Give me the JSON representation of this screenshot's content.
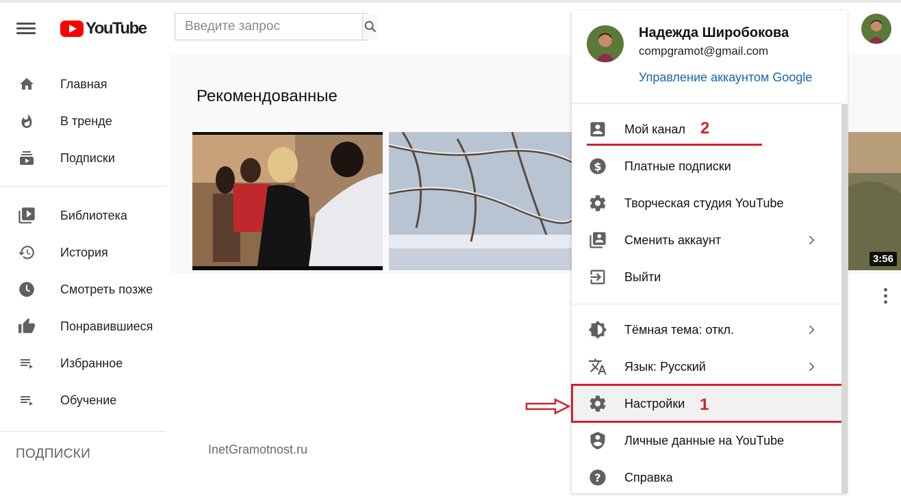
{
  "header": {
    "logo_text": "YouTube",
    "search_placeholder": "Введите запрос"
  },
  "sidebar": {
    "items": [
      {
        "label": "Главная",
        "icon": "home-icon"
      },
      {
        "label": "В тренде",
        "icon": "fire-icon"
      },
      {
        "label": "Подписки",
        "icon": "subscriptions-icon"
      },
      {
        "label": "Библиотека",
        "icon": "library-icon"
      },
      {
        "label": "История",
        "icon": "history-icon"
      },
      {
        "label": "Смотреть позже",
        "icon": "clock-icon"
      },
      {
        "label": "Понравившиеся",
        "icon": "thumbs-up-icon"
      },
      {
        "label": "Избранное",
        "icon": "playlist-icon"
      },
      {
        "label": "Обучение",
        "icon": "playlist-icon"
      }
    ],
    "subscriptions_title": "ПОДПИСКИ"
  },
  "main": {
    "section_title": "Рекомендованные",
    "video_duration": "3:56",
    "watermark": "InetGramotnost.ru"
  },
  "account_menu": {
    "name": "Надежда Широбокова",
    "email": "compgramot@gmail.com",
    "manage_link": "Управление аккаунтом Google",
    "items": [
      {
        "label": "Мой канал",
        "icon": "account-box-icon"
      },
      {
        "label": "Платные подписки",
        "icon": "dollar-icon"
      },
      {
        "label": "Творческая студия YouTube",
        "icon": "gear-icon"
      },
      {
        "label": "Сменить аккаунт",
        "icon": "switch-account-icon"
      },
      {
        "label": "Выйти",
        "icon": "sign-out-icon"
      },
      {
        "label": "Тёмная тема: откл.",
        "icon": "dark-theme-icon"
      },
      {
        "label": "Язык: Русский",
        "icon": "translate-icon"
      },
      {
        "label": "Настройки",
        "icon": "gear-icon"
      },
      {
        "label": "Личные данные на YouTube",
        "icon": "shield-person-icon"
      },
      {
        "label": "Справка",
        "icon": "help-icon"
      }
    ]
  },
  "annotations": {
    "step1": "1",
    "step2": "2",
    "accent_color": "#d0222a"
  },
  "colors": {
    "brand_red": "#ff0000",
    "link_blue": "#1a66b0",
    "icon_gray": "#606060"
  }
}
